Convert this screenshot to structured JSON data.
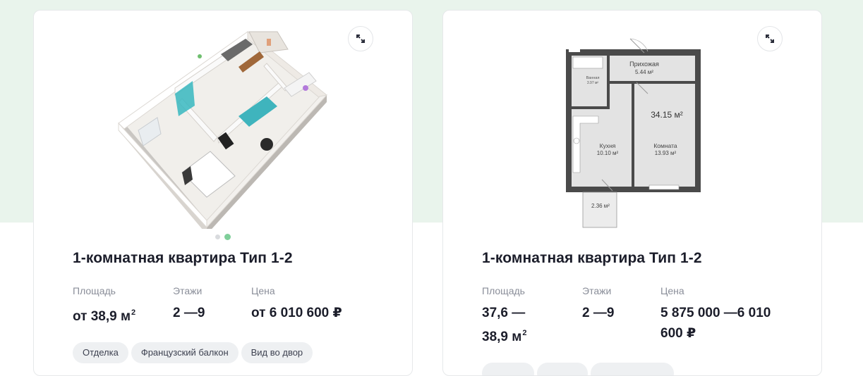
{
  "cards": [
    {
      "title": "1-комнатная квартира Тип 1-2",
      "area_label": "Площадь",
      "area_value": "от 38,9 м",
      "area_unit_sup": "2",
      "floors_label": "Этажи",
      "floors_value": "2 —9",
      "price_label": "Цена",
      "price_value": "от 6 010 600 ₽",
      "slides": 2,
      "active_slide": 2,
      "tags": [
        "Отделка",
        "Французский балкон",
        "Вид во двор"
      ],
      "image": "3d-floorplan-render"
    },
    {
      "title": "1-комнатная квартира Тип 1-2",
      "area_label": "Площадь",
      "area_value_line1": "37,6 —",
      "area_value_line2": "38,9 м",
      "area_unit_sup": "2",
      "floors_label": "Этажи",
      "floors_value": "2 —9",
      "price_label": "Цена",
      "price_value_line1": "5 875 000 —6 010",
      "price_value_line2": "600 ₽",
      "image": "2d-floorplan",
      "plan": {
        "hall_label": "Прихожая",
        "hall_area": "5.44 м²",
        "bath_label": "Ванная",
        "bath_area": "3.97 м²",
        "total_area": "34.15 м²",
        "kitchen_label": "Кухня",
        "kitchen_area": "10.10 м²",
        "room_label": "Комната",
        "room_area": "13.93 м²",
        "balcony_area": "2.36 м²"
      }
    }
  ],
  "colors": {
    "background_band": "#e9f4ec",
    "accent_dot": "#7fcf9a",
    "wall": "#4a4a4a",
    "floor": "#e2e2e2"
  }
}
